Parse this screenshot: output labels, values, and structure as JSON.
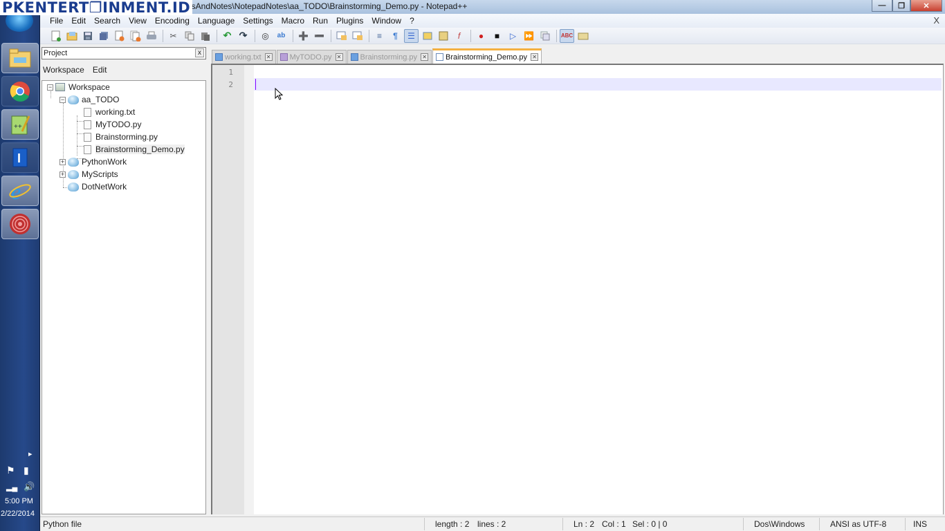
{
  "watermark": "PKENTERT❐INMENT.ID",
  "window": {
    "title": "ocsAndNotes\\NotepadNotes\\aa_TODO\\Brainstorming_Demo.py - Notepad++",
    "minimize_icon": "minimize-icon",
    "maximize_icon": "maximize-icon",
    "close_icon": "close-icon"
  },
  "menubar": {
    "items": [
      "File",
      "Edit",
      "Search",
      "View",
      "Encoding",
      "Language",
      "Settings",
      "Macro",
      "Run",
      "Plugins",
      "Window",
      "?"
    ],
    "close_label": "X"
  },
  "toolbar": {
    "groups": [
      [
        "new-file",
        "open-file",
        "save",
        "save-all",
        "close",
        "close-all",
        "print"
      ],
      [
        "cut",
        "copy",
        "paste"
      ],
      [
        "undo",
        "redo"
      ],
      [
        "find",
        "replace"
      ],
      [
        "zoom-in",
        "zoom-out"
      ],
      [
        "sync-vertical",
        "sync-horizontal"
      ],
      [
        "word-wrap",
        "show-all-chars",
        "indent-guide",
        "user-defined-lang",
        "doc-map",
        "function-list"
      ],
      [
        "record-macro",
        "stop-record",
        "play-macro",
        "run-macro-multiple",
        "save-macro"
      ],
      [
        "spell-check",
        "plugin-folder"
      ]
    ]
  },
  "taskbar": {
    "apps": [
      "file-explorer-icon",
      "chrome-icon",
      "notepadpp-icon",
      "app-i-icon",
      "internet-explorer-icon",
      "target-app-icon"
    ],
    "time": "5:00 PM",
    "date": "2/22/2014"
  },
  "panel": {
    "title": "Project",
    "close_label": "x",
    "menu": [
      "Workspace",
      "Edit"
    ],
    "tree": {
      "workspace": "Workspace",
      "projects": [
        {
          "name": "aa_TODO",
          "expanded": true,
          "files": [
            "working.txt",
            "MyTODO.py",
            "Brainstorming.py",
            "Brainstorming_Demo.py"
          ]
        },
        {
          "name": "PythonWork",
          "expanded": false,
          "files": []
        },
        {
          "name": "MyScripts",
          "expanded": false,
          "files": []
        },
        {
          "name": "DotNetWork",
          "expanded": false,
          "files": []
        }
      ]
    }
  },
  "tabs": [
    {
      "label": "working.txt",
      "active": false
    },
    {
      "label": "MyTODO.py",
      "active": false
    },
    {
      "label": "Brainstorming.py",
      "active": false
    },
    {
      "label": "Brainstorming_Demo.py",
      "active": true
    }
  ],
  "editor": {
    "line_numbers": [
      "1",
      "2"
    ],
    "current_line": 2
  },
  "statusbar": {
    "file_type": "Python file",
    "length": "length : 2",
    "lines": "lines : 2",
    "ln": "Ln : 2",
    "col": "Col : 1",
    "sel": "Sel : 0 | 0",
    "eol": "Dos\\Windows",
    "encoding": "ANSI as UTF-8",
    "mode": "INS"
  }
}
